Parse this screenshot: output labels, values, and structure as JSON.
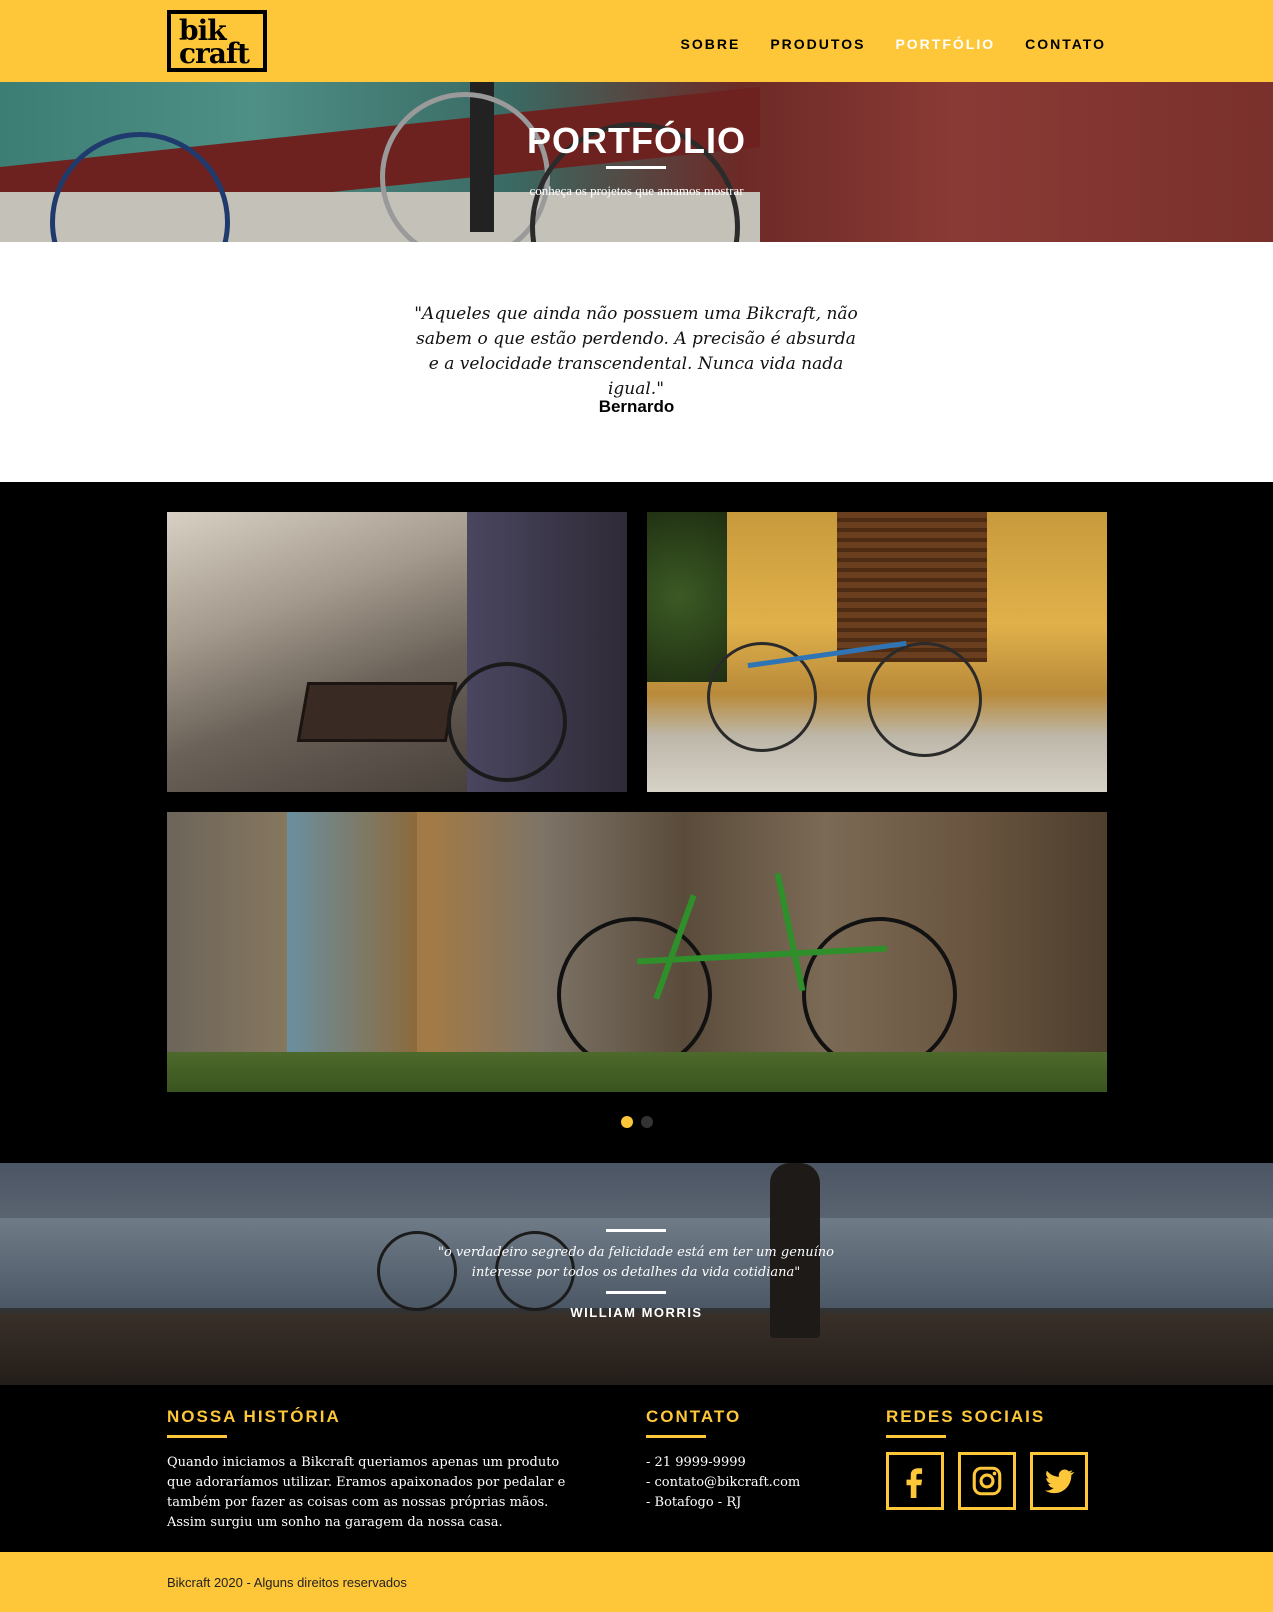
{
  "brand": {
    "logo_line1": "bik",
    "logo_line2": "craft",
    "accent": "#FEC739"
  },
  "nav": {
    "items": [
      {
        "label": "SOBRE"
      },
      {
        "label": "PRODUTOS"
      },
      {
        "label": "PORTFÓLIO",
        "active": true
      },
      {
        "label": "CONTATO"
      }
    ]
  },
  "hero": {
    "title": "PORTFÓLIO",
    "subtitle": "conheça os projetos que amamos mostrar"
  },
  "testimonial": {
    "quote": "\"Aqueles que ainda não possuem uma Bikcraft, não sabem o que estão perdendo. A precisão é absurda e a velocidade transcendental. Nunca vida nada igual.\"",
    "author": "Bernardo"
  },
  "gallery": {
    "slide_count": 2,
    "active_slide": 1
  },
  "banner": {
    "quote": "\"o verdadeiro segredo da felicidade está em ter um genuíno interesse por todos os detalhes da vida cotidiana\"",
    "author": "WILLIAM MORRIS"
  },
  "footer": {
    "history": {
      "title": "NOSSA HISTÓRIA",
      "text": "Quando iniciamos a Bikcraft queriamos apenas um produto que adoraríamos utilizar. Eramos apaixonados por pedalar e também por fazer as coisas com as nossas próprias mãos. Assim surgiu um sonho na garagem da nossa casa."
    },
    "contact": {
      "title": "CONTATO",
      "lines": [
        "- 21 9999-9999",
        "- contato@bikcraft.com",
        "- Botafogo - RJ"
      ]
    },
    "social": {
      "title": "REDES SOCIAIS",
      "icons": [
        "facebook-icon",
        "instagram-icon",
        "twitter-icon"
      ]
    }
  },
  "copyright": "Bikcraft 2020 - Alguns direitos reservados"
}
